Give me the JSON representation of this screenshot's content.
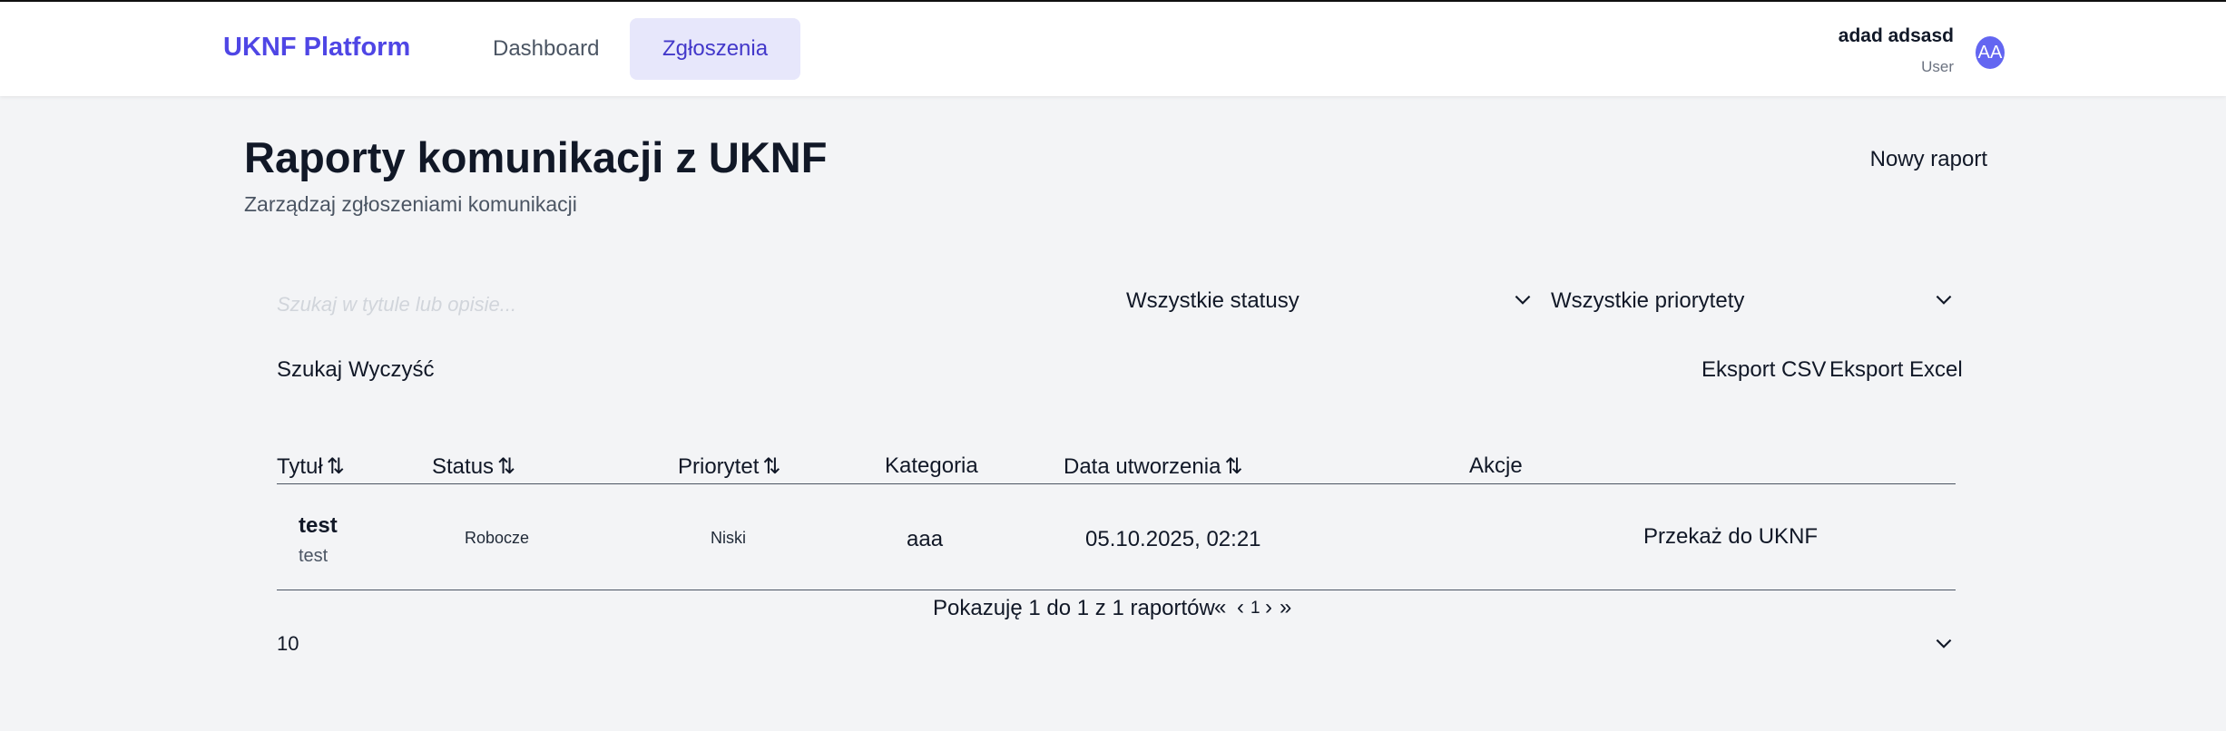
{
  "navbar": {
    "brand": "UKNF Platform",
    "links": [
      {
        "label": "Dashboard",
        "active": false
      },
      {
        "label": "Zgłoszenia",
        "active": true
      }
    ],
    "user": {
      "name": "adad adsasd",
      "role": "User",
      "initials": "AA"
    }
  },
  "page": {
    "title": "Raporty komunikacji z UKNF",
    "subtitle": "Zarządzaj zgłoszeniami komunikacji",
    "new_report_label": "Nowy raport"
  },
  "filters": {
    "search_placeholder": "Szukaj w tytule lub opisie...",
    "search_value": "",
    "status_selected": "Wszystkie statusy",
    "priority_selected": "Wszystkie priorytety",
    "search_button": "Szukaj",
    "clear_button": "Wyczyść",
    "export_csv": "Eksport CSV",
    "export_excel": "Eksport Excel"
  },
  "table": {
    "columns": [
      "Tytuł",
      "Status",
      "Priorytet",
      "Kategoria",
      "Data utworzenia",
      "Akcje"
    ],
    "sort_icon": "⇅",
    "rows": [
      {
        "title": "test",
        "description": "test",
        "status": "Robocze",
        "priority": "Niski",
        "category": "aaa",
        "created": "05.10.2025, 02:21",
        "action": "Przekaż do UKNF"
      }
    ]
  },
  "pagination": {
    "summary": "Pokazuję 1 do 1 z 1 raportów",
    "first": "«",
    "prev": "‹",
    "current_page": "1",
    "next": "›",
    "last": "»",
    "page_size": "10"
  },
  "colors": {
    "brand": "#4f46e5",
    "active_tab_bg": "#e7e7fb",
    "avatar": "#6366f1",
    "background": "#f3f4f6"
  }
}
